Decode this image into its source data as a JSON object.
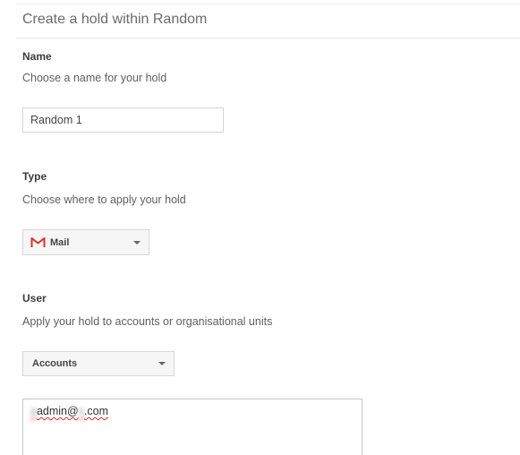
{
  "header": {
    "title": "Create a hold within Random"
  },
  "name_section": {
    "title": "Name",
    "description": "Choose a name for your hold",
    "value": "Random 1"
  },
  "type_section": {
    "title": "Type",
    "description": "Choose where to apply your hold",
    "selected": "Mail",
    "icon": "gmail-icon",
    "icon_color": "#d93025"
  },
  "user_section": {
    "title": "User",
    "description": "Apply your hold to accounts or organisational units",
    "selected": "Accounts",
    "account_prefix": "a",
    "account_middle": "admin@",
    "account_domain_redacted": "s",
    "account_suffix": ".com"
  }
}
